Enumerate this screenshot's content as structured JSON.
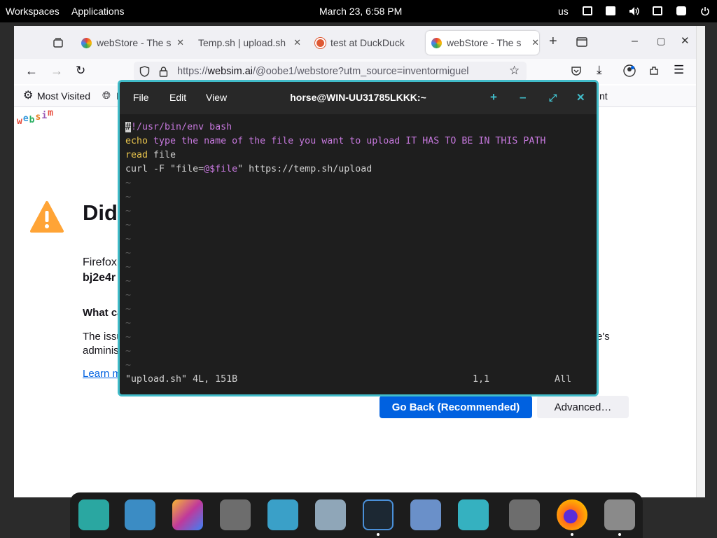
{
  "topbar": {
    "workspaces": "Workspaces",
    "applications": "Applications",
    "clock": "March 23, 6:58 PM",
    "keyboard_layout": "us"
  },
  "browser": {
    "tabs": [
      {
        "label": "webStore - The s",
        "icon": "chrome-like-icon",
        "active": false
      },
      {
        "label": "Temp.sh | upload.sh",
        "icon": "none",
        "active": false
      },
      {
        "label": "test at DuckDuck",
        "icon": "duckduckgo-icon",
        "active": false
      },
      {
        "label": "webStore - The s",
        "icon": "chrome-like-icon",
        "active": true
      }
    ],
    "url_prefix": "https://",
    "url_domain": "websim.ai",
    "url_rest": "/@oobe1/webstore?utm_source=inventormiguel",
    "bookmarks": {
      "most_visited": "Most Visited",
      "partial_left": "I",
      "partial_right": "nt"
    }
  },
  "page": {
    "logo_letters": [
      {
        "ch": "w",
        "color": "#e74c3c"
      },
      {
        "ch": "e",
        "color": "#3498db"
      },
      {
        "ch": "b",
        "color": "#27ae60"
      },
      {
        "ch": "s",
        "color": "#e67e22"
      },
      {
        "ch": "i",
        "color": "#9b59b6"
      },
      {
        "ch": "m",
        "color": "#e74c3c"
      }
    ],
    "heading_partial": "Did",
    "line1_partial": "Firefox",
    "line2_partial": "bj2e4r",
    "what_partial": "What ca",
    "issue_partial": "The issu",
    "issue_right_partial": "e's",
    "admin_partial": "adminis",
    "learn_partial": "Learn m",
    "go_back_label": "Go Back (Recommended)",
    "advanced_label": "Advanced…"
  },
  "terminal": {
    "menu": {
      "file": "File",
      "edit": "Edit",
      "view": "View"
    },
    "title": "horse@WIN-UU31785LKKK:~",
    "lines": {
      "shebang_cursor": "#",
      "shebang_rest": "!/usr/bin/env bash",
      "echo_kw": "echo",
      "echo_rest": " type the name of the file you want to upload IT HAS TO BE IN THIS PATH",
      "read_kw": "read",
      "read_rest": " file",
      "curl_a": "curl -F ",
      "curl_q1": "\"file=",
      "curl_at": "@$file",
      "curl_q2": "\"",
      "curl_rest": " https://temp.sh/upload"
    },
    "tilde": "~",
    "status_file": "\"upload.sh\" 4L, 151B",
    "status_pos": "1,1",
    "status_all": "All"
  },
  "dock_apps": [
    "search-app-icon",
    "window-switcher-icon",
    "app-grid-icon",
    "settings-tweaks-icon",
    "files-icon",
    "text-editor-icon",
    "terminal-icon",
    "software-installer-icon",
    "toggle-app-icon",
    "settings-tweaks-2-icon",
    "firefox-icon",
    "settings-icon"
  ],
  "colors": {
    "terminal_border": "#41bcc9",
    "primary_button": "#0061e0",
    "warning": "#ffa436"
  }
}
